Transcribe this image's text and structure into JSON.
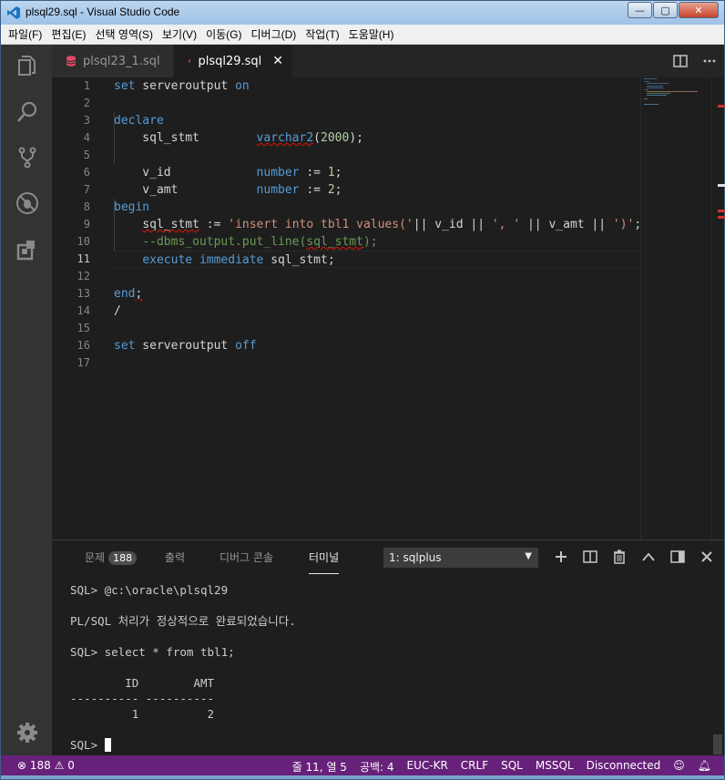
{
  "window": {
    "title": "plsql29.sql - Visual Studio Code",
    "buttons": {
      "minimize": "—",
      "maximize": "▢",
      "close": "✕"
    }
  },
  "menubar": [
    "파일(F)",
    "편집(E)",
    "선택 영역(S)",
    "보기(V)",
    "이동(G)",
    "디버그(D)",
    "작업(T)",
    "도움말(H)"
  ],
  "activitybar": [
    "explorer-icon",
    "search-icon",
    "source-control-icon",
    "debug-icon",
    "extensions-icon",
    "settings-gear-icon"
  ],
  "tabs": [
    {
      "label": "plsql23_1.sql",
      "active": false
    },
    {
      "label": "plsql29.sql",
      "active": true,
      "close": "✕"
    }
  ],
  "editor": {
    "current_line": 11,
    "line_numbers": [
      "1",
      "2",
      "3",
      "4",
      "5",
      "6",
      "7",
      "8",
      "9",
      "10",
      "11",
      "12",
      "13",
      "14",
      "15",
      "16",
      "17"
    ]
  },
  "panel": {
    "tabs": {
      "problems": "문제",
      "problems_count": "188",
      "output": "출력",
      "debug_console": "디버그 콘솔",
      "terminal": "터미널"
    },
    "terminal_select": "1: sqlplus",
    "terminal_lines": [
      "SQL> @c:\\oracle\\plsql29",
      "",
      "PL/SQL 처리가 정상적으로 완료되었습니다.",
      "",
      "SQL> select * from tbl1;",
      "",
      "        ID        AMT",
      "---------- ----------",
      "         1          2",
      "",
      "SQL> "
    ]
  },
  "statusbar": {
    "errors": "188",
    "warnings": "0",
    "position": "줄 11, 열 5",
    "spaces": "공백: 4",
    "encoding": "EUC-KR",
    "eol": "CRLF",
    "language": "SQL",
    "dialect": "MSSQL",
    "connection": "Disconnected"
  },
  "colors": {
    "statusbar": "#68217a",
    "keyword": "#569cd6",
    "string": "#ce9178",
    "number": "#b5cea8",
    "comment": "#6a9955"
  }
}
